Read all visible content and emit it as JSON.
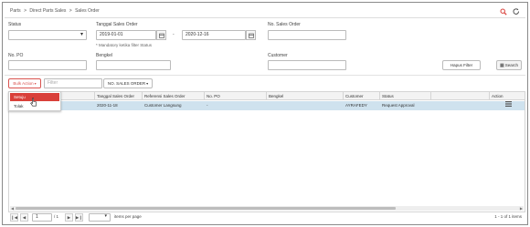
{
  "breadcrumb": {
    "items": [
      "Parts",
      ">",
      "Direct Parts Sales",
      ">",
      "Sales Order"
    ]
  },
  "top_icons": {
    "search": "search-icon",
    "refresh": "refresh-icon"
  },
  "filters": {
    "status_label": "Status",
    "status_value": "",
    "date_label": "Tanggal Sales Order",
    "date_from": "2019-01-01",
    "date_to": "2020-12-16",
    "date_separator": "-",
    "date_hint": "* Mandatory ketika filter Status",
    "so_no_label": "No. Sales Order",
    "so_no_value": "",
    "po_label": "No. PO",
    "po_value": "",
    "bengkel_label": "Bengkel",
    "bengkel_value": "",
    "customer_label": "Customer",
    "customer_value": "",
    "clear_button": "Hapus Filter",
    "search_button": "Search"
  },
  "toolbar": {
    "bulk_action": "Bulk Action",
    "filter_placeholder": "Filter",
    "field_selector": "NO. SALES ORDER"
  },
  "bulk_menu": {
    "items": [
      "Setuju",
      "Tolak"
    ],
    "active_index": 0
  },
  "grid": {
    "columns": [
      "",
      "Tanggal Sales Order",
      "Referensi Sales Order",
      "No. PO",
      "Bengkel",
      "Customer",
      "Status",
      "",
      "Action"
    ],
    "rows": [
      [
        "",
        "2020-11-18",
        "Customer Langsung",
        "-",
        "",
        "AYRAFEDY",
        "Request Approval",
        "",
        "list-icon"
      ]
    ]
  },
  "pager": {
    "page": "1",
    "of_pages": "/ 1",
    "per_page_label": "items per page",
    "per_page_value": "",
    "summary": "1 - 1 of 1 items"
  },
  "colors": {
    "accent": "#d9403a",
    "row_selected": "#cfe2ee"
  }
}
